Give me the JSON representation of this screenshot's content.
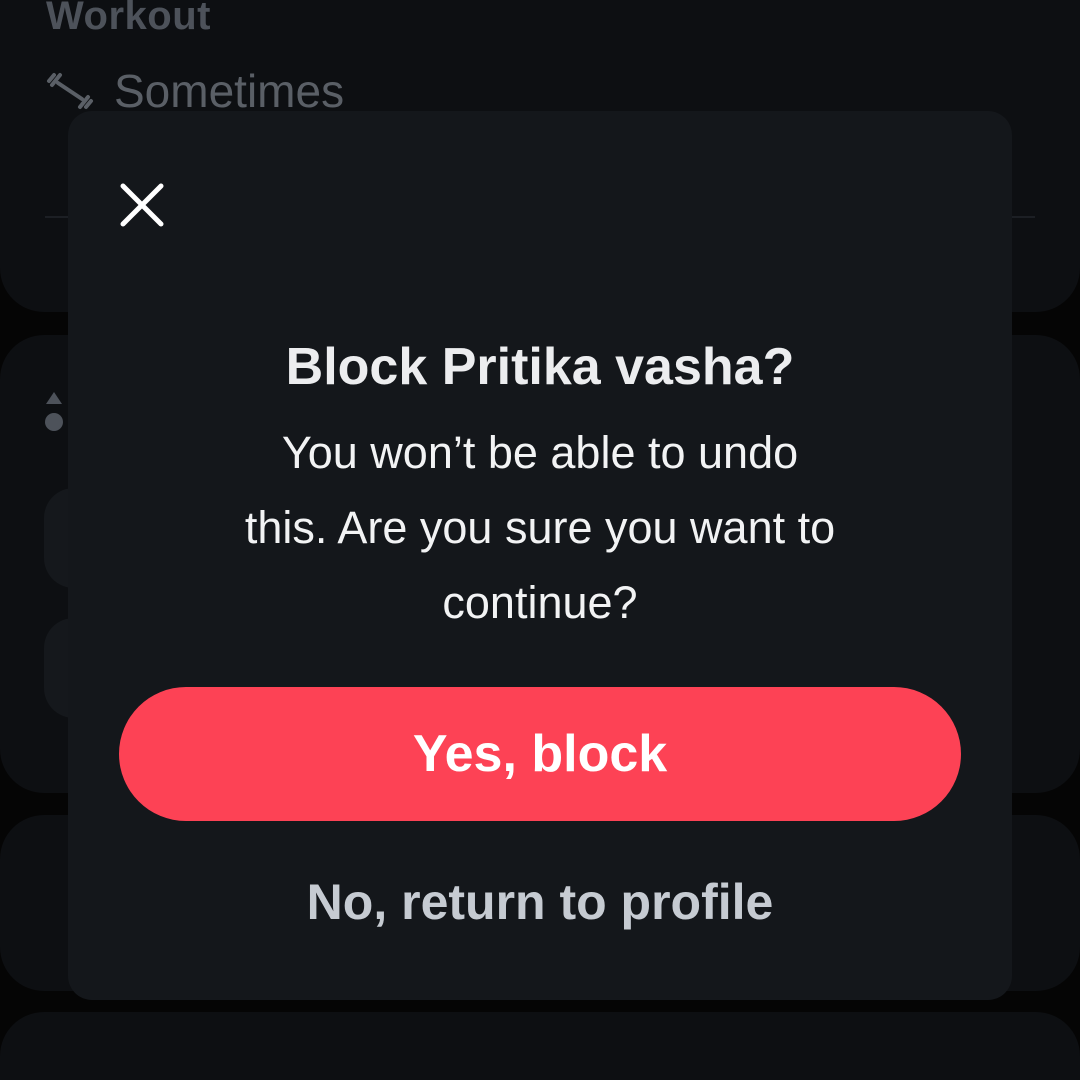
{
  "background": {
    "section_title": "Workout",
    "workout_row": {
      "icon": "dumbbell-icon",
      "value": "Sometimes"
    },
    "second_section_icon": "shapes-icon"
  },
  "modal": {
    "close_icon": "close-icon",
    "title": "Block Pritika vasha?",
    "body_line1": "You won’t be able to undo",
    "body_line2": "this. Are you sure you want to",
    "body_line3": "continue?",
    "primary_label": "Yes, block",
    "secondary_label": "No, return to profile"
  },
  "colors": {
    "modal_background": "#14171b",
    "primary_button": "#fd4255",
    "primary_text": "#ffffff",
    "secondary_text": "#c6cbd2",
    "page_background": "#050505"
  }
}
